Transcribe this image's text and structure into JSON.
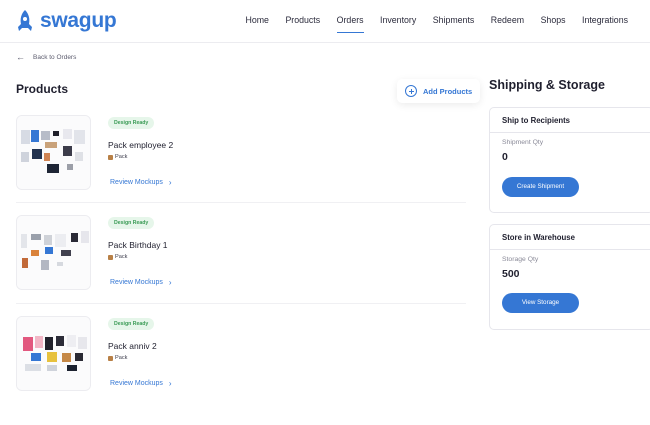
{
  "brand": {
    "name": "swagup",
    "color": "#3577d4"
  },
  "nav": {
    "items": [
      {
        "label": "Home"
      },
      {
        "label": "Products"
      },
      {
        "label": "Orders"
      },
      {
        "label": "Inventory"
      },
      {
        "label": "Shipments"
      },
      {
        "label": "Redeem"
      },
      {
        "label": "Shops"
      },
      {
        "label": "Integrations"
      }
    ],
    "active": "Orders"
  },
  "back": {
    "label": "Back to Orders",
    "icon": "arrow-left-icon"
  },
  "products": {
    "title": "Products",
    "add_label": "Add Products",
    "items": [
      {
        "badge": "Design Ready",
        "name": "Pack employee 2",
        "type": "Pack",
        "link": "Review Mockups"
      },
      {
        "badge": "Design Ready",
        "name": "Pack Birthday 1",
        "type": "Pack",
        "link": "Review Mockups"
      },
      {
        "badge": "Design Ready",
        "name": "Pack anniv 2",
        "type": "Pack",
        "link": "Review Mockups"
      }
    ]
  },
  "shipping_storage": {
    "title": "Shipping & Storage",
    "ship": {
      "heading": "Ship to Recipients",
      "qty_label": "Shipment Qty",
      "qty": "0",
      "button": "Create Shipment"
    },
    "store": {
      "heading": "Store in Warehouse",
      "qty_label": "Storage Qty",
      "qty": "500",
      "button": "View Storage"
    }
  },
  "colors": {
    "accent": "#3577d4",
    "badge_bg": "#e6f6ea",
    "badge_text": "#3a9b55"
  }
}
